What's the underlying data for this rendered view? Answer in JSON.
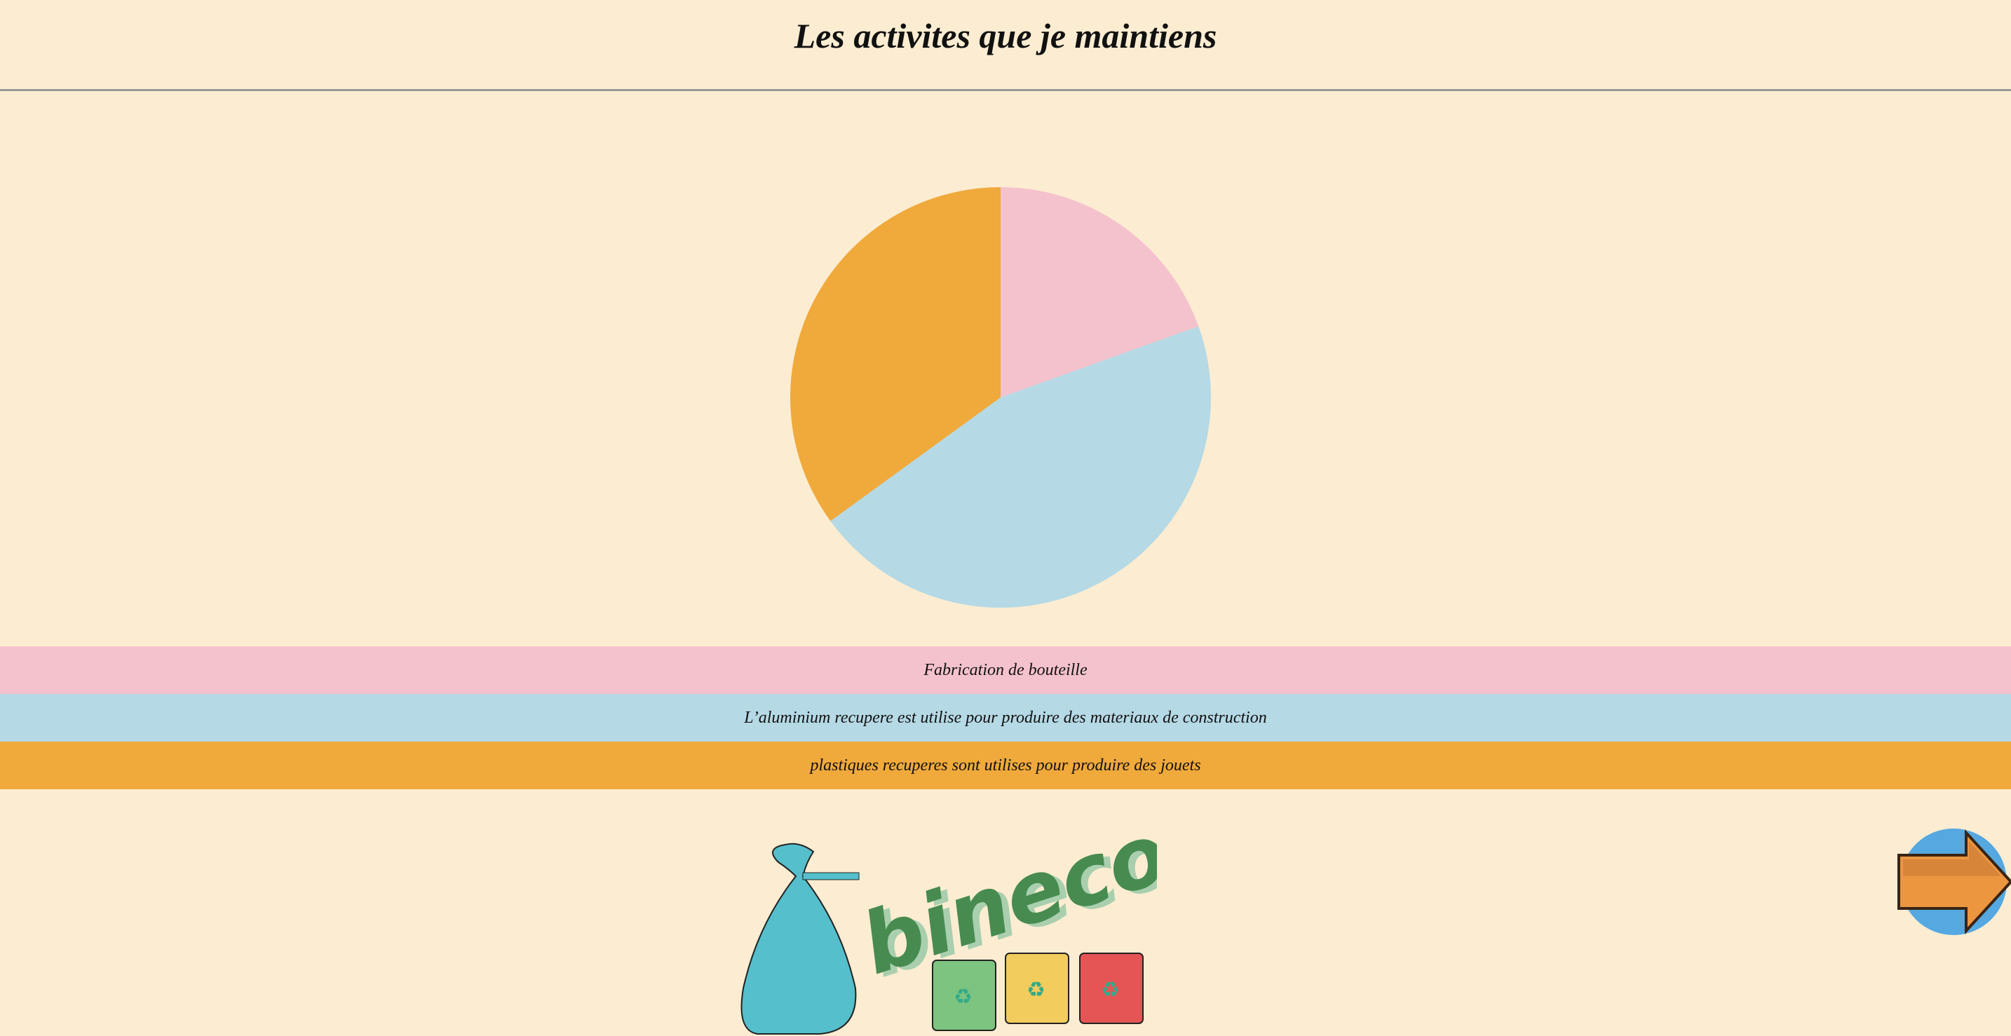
{
  "header": {
    "title": "Les activites que je maintiens"
  },
  "chart_data": {
    "type": "pie",
    "title": "Les activites que je maintiens",
    "categories": [
      "Fabrication de bouteille",
      "L’aluminium recupere est utilise pour produire des materiaux de construction",
      "plastiques recuperes sont utilises pour produire des jouets"
    ],
    "values": [
      19.5,
      45.5,
      35
    ],
    "colors": [
      "#f4c2cc",
      "#b5d9e5",
      "#f0a93b"
    ],
    "legend": "bottom"
  },
  "logo": {
    "text": "bineco"
  },
  "nav": {
    "next_icon": "arrow-right-icon"
  }
}
